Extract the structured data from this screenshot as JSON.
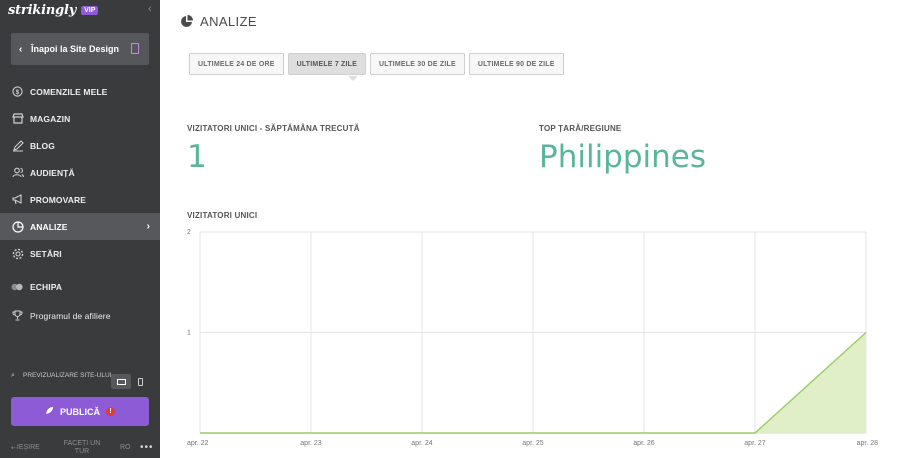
{
  "app": {
    "brand": "strikingly",
    "vip_badge": "VIP"
  },
  "sidebar": {
    "back_label": "Înapoi la Site Design",
    "items": [
      {
        "label": "COMENZILE MELE",
        "icon": "dollar-circle-icon"
      },
      {
        "label": "MAGAZIN",
        "icon": "store-icon"
      },
      {
        "label": "BLOG",
        "icon": "pen-icon"
      },
      {
        "label": "AUDIENȚĂ",
        "icon": "users-icon"
      },
      {
        "label": "PROMOVARE",
        "icon": "megaphone-icon"
      },
      {
        "label": "ANALIZE",
        "icon": "pie-chart-icon",
        "active": true
      },
      {
        "label": "SETĂRI",
        "icon": "gear-icon"
      },
      {
        "label": "ECHIPA",
        "icon": "team-icon"
      },
      {
        "label": "Programul de afiliere",
        "icon": "trophy-icon"
      }
    ],
    "preview_label": "PREVIZUALIZARE SITE-ULUI",
    "publish_label": "PUBLICĂ",
    "publish_alert": "!",
    "footer": {
      "exit": "IEȘIRE",
      "tour": "FACEȚI UN TUR",
      "lang": "RO",
      "more": "•••"
    }
  },
  "main": {
    "title": "ANALIZE",
    "range_tabs": [
      {
        "label": "ULTIMELE 24 DE ORE",
        "active": false
      },
      {
        "label": "ULTIMELE 7 ZILE",
        "active": true
      },
      {
        "label": "ULTIMELE 30 DE ZILE",
        "active": false
      },
      {
        "label": "ULTIMELE 90 DE ZILE",
        "active": false
      }
    ],
    "unique_visitors_label": "VIZITATORI UNICI - SĂPTĂMÂNA TRECUTĂ",
    "unique_visitors_value": "1",
    "top_country_label": "TOP ȚARĂ/REGIUNE",
    "top_country_value": "Philippines",
    "chart_title": "VIZITATORI UNICI"
  },
  "colors": {
    "sidebar_bg": "#3a3b3d",
    "accent_purple": "#8e5bd6",
    "stat_green": "#5bb59c",
    "chart_line": "#9ccc65",
    "chart_fill": "#e1efc9"
  },
  "chart_data": {
    "type": "area",
    "title": "VIZITATORI UNICI",
    "x": [
      "apr. 22",
      "apr. 23",
      "apr. 24",
      "apr. 25",
      "apr. 26",
      "apr. 27",
      "apr. 28"
    ],
    "series": [
      {
        "values": [
          0,
          0,
          0,
          0,
          0,
          0,
          1
        ]
      }
    ],
    "ylim": [
      0,
      2
    ],
    "yticks": [
      "1",
      "2"
    ],
    "grid": true,
    "legend": "none"
  }
}
